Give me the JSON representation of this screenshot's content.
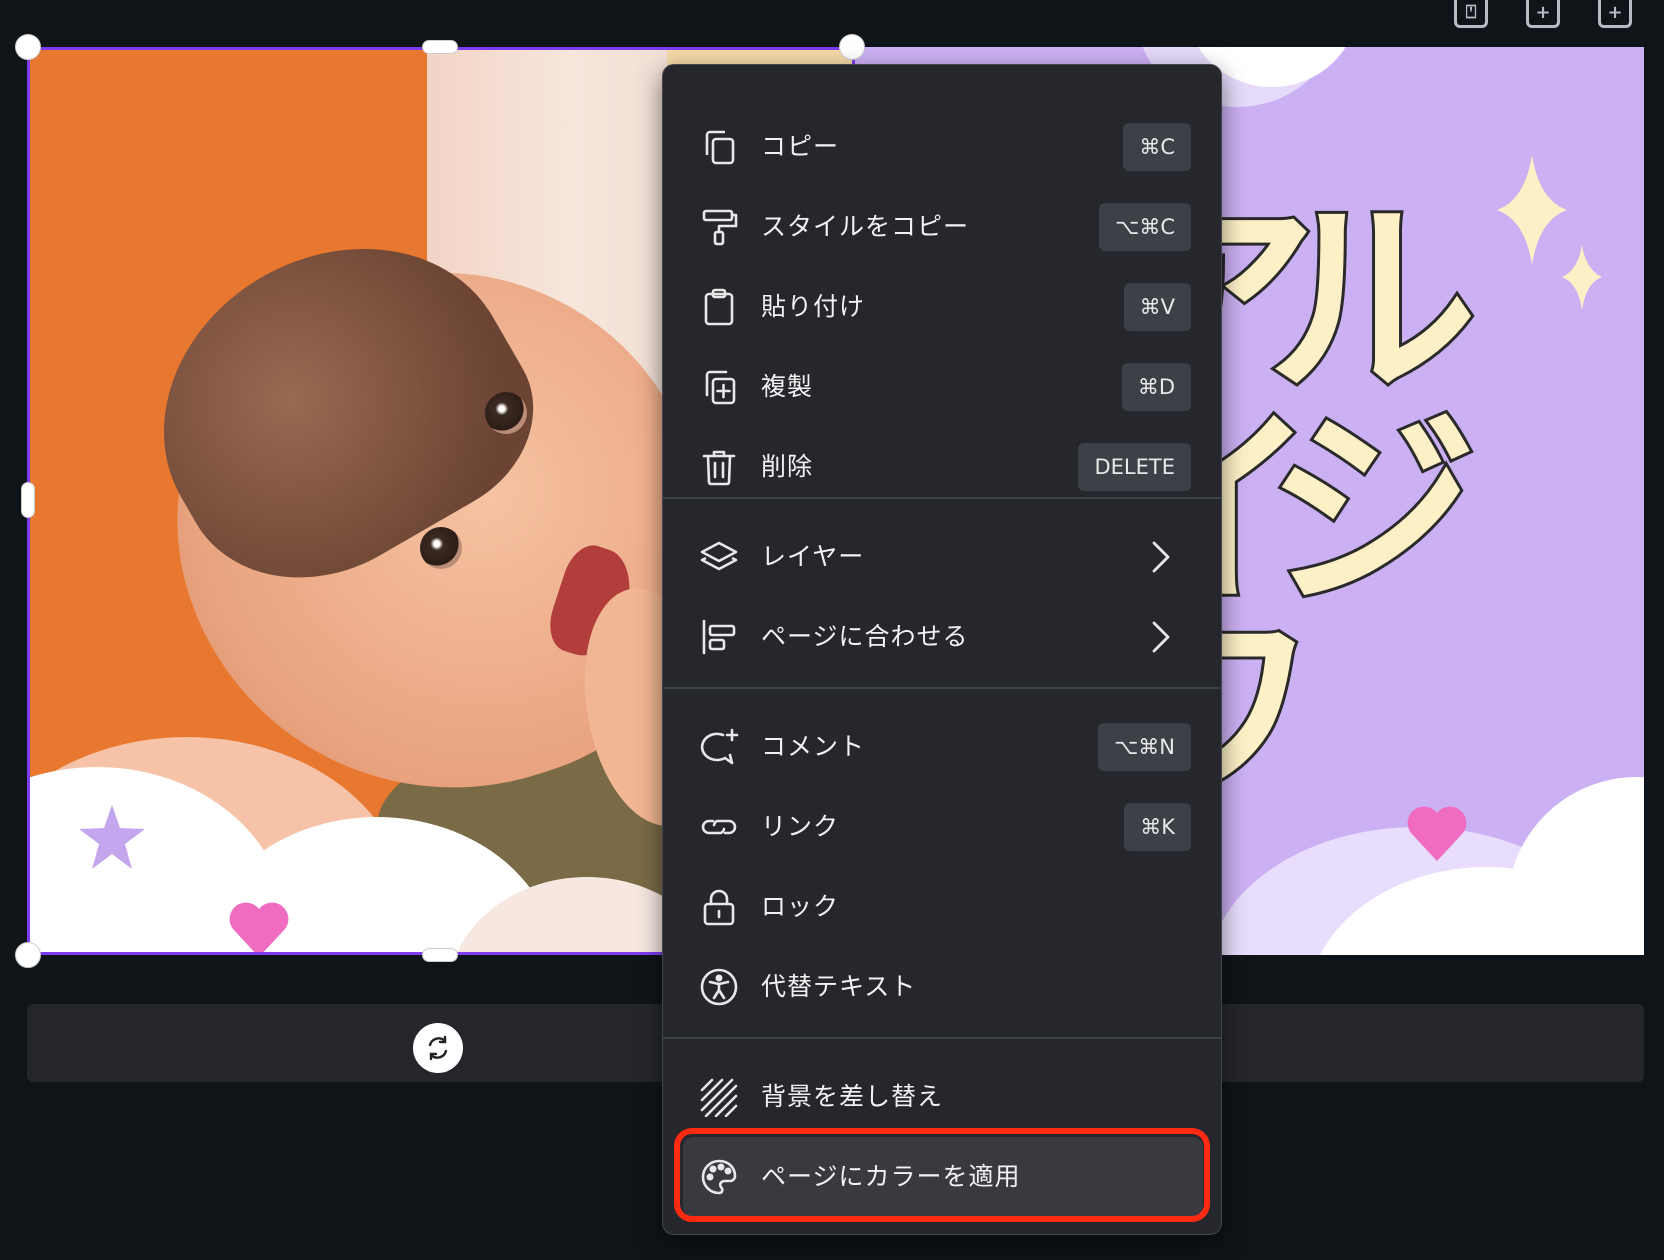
{
  "toolbar": {
    "icons": [
      "lock-add-page-icon",
      "duplicate-page-icon",
      "add-page-icon"
    ]
  },
  "canvas": {
    "background_color": "#cbb0f3",
    "accent_color": "#7d3cf0"
  },
  "menu": {
    "items": [
      {
        "label": "コピー",
        "shortcut": "⌘C",
        "icon": "copy-icon"
      },
      {
        "label": "スタイルをコピー",
        "shortcut": "⌥⌘C",
        "icon": "paint-roller-icon"
      },
      {
        "label": "貼り付け",
        "shortcut": "⌘V",
        "icon": "clipboard-icon"
      },
      {
        "label": "複製",
        "shortcut": "⌘D",
        "icon": "duplicate-icon"
      },
      {
        "label": "削除",
        "shortcut": "DELETE",
        "icon": "trash-icon"
      },
      {
        "label": "レイヤー",
        "icon": "layers-icon"
      },
      {
        "label": "ページに合わせる",
        "icon": "align-left-icon"
      },
      {
        "label": "コメント",
        "shortcut": "⌥⌘N",
        "icon": "comment-add-icon"
      },
      {
        "label": "リンク",
        "shortcut": "⌘K",
        "icon": "link-icon"
      },
      {
        "label": "ロック",
        "icon": "lock-icon"
      },
      {
        "label": "代替テキスト",
        "icon": "accessibility-icon"
      },
      {
        "label": "背景を差し替え",
        "icon": "background-pattern-icon"
      },
      {
        "label": "ページにカラーを適用",
        "icon": "palette-icon"
      }
    ],
    "highlight_color": "#ff2a12"
  }
}
